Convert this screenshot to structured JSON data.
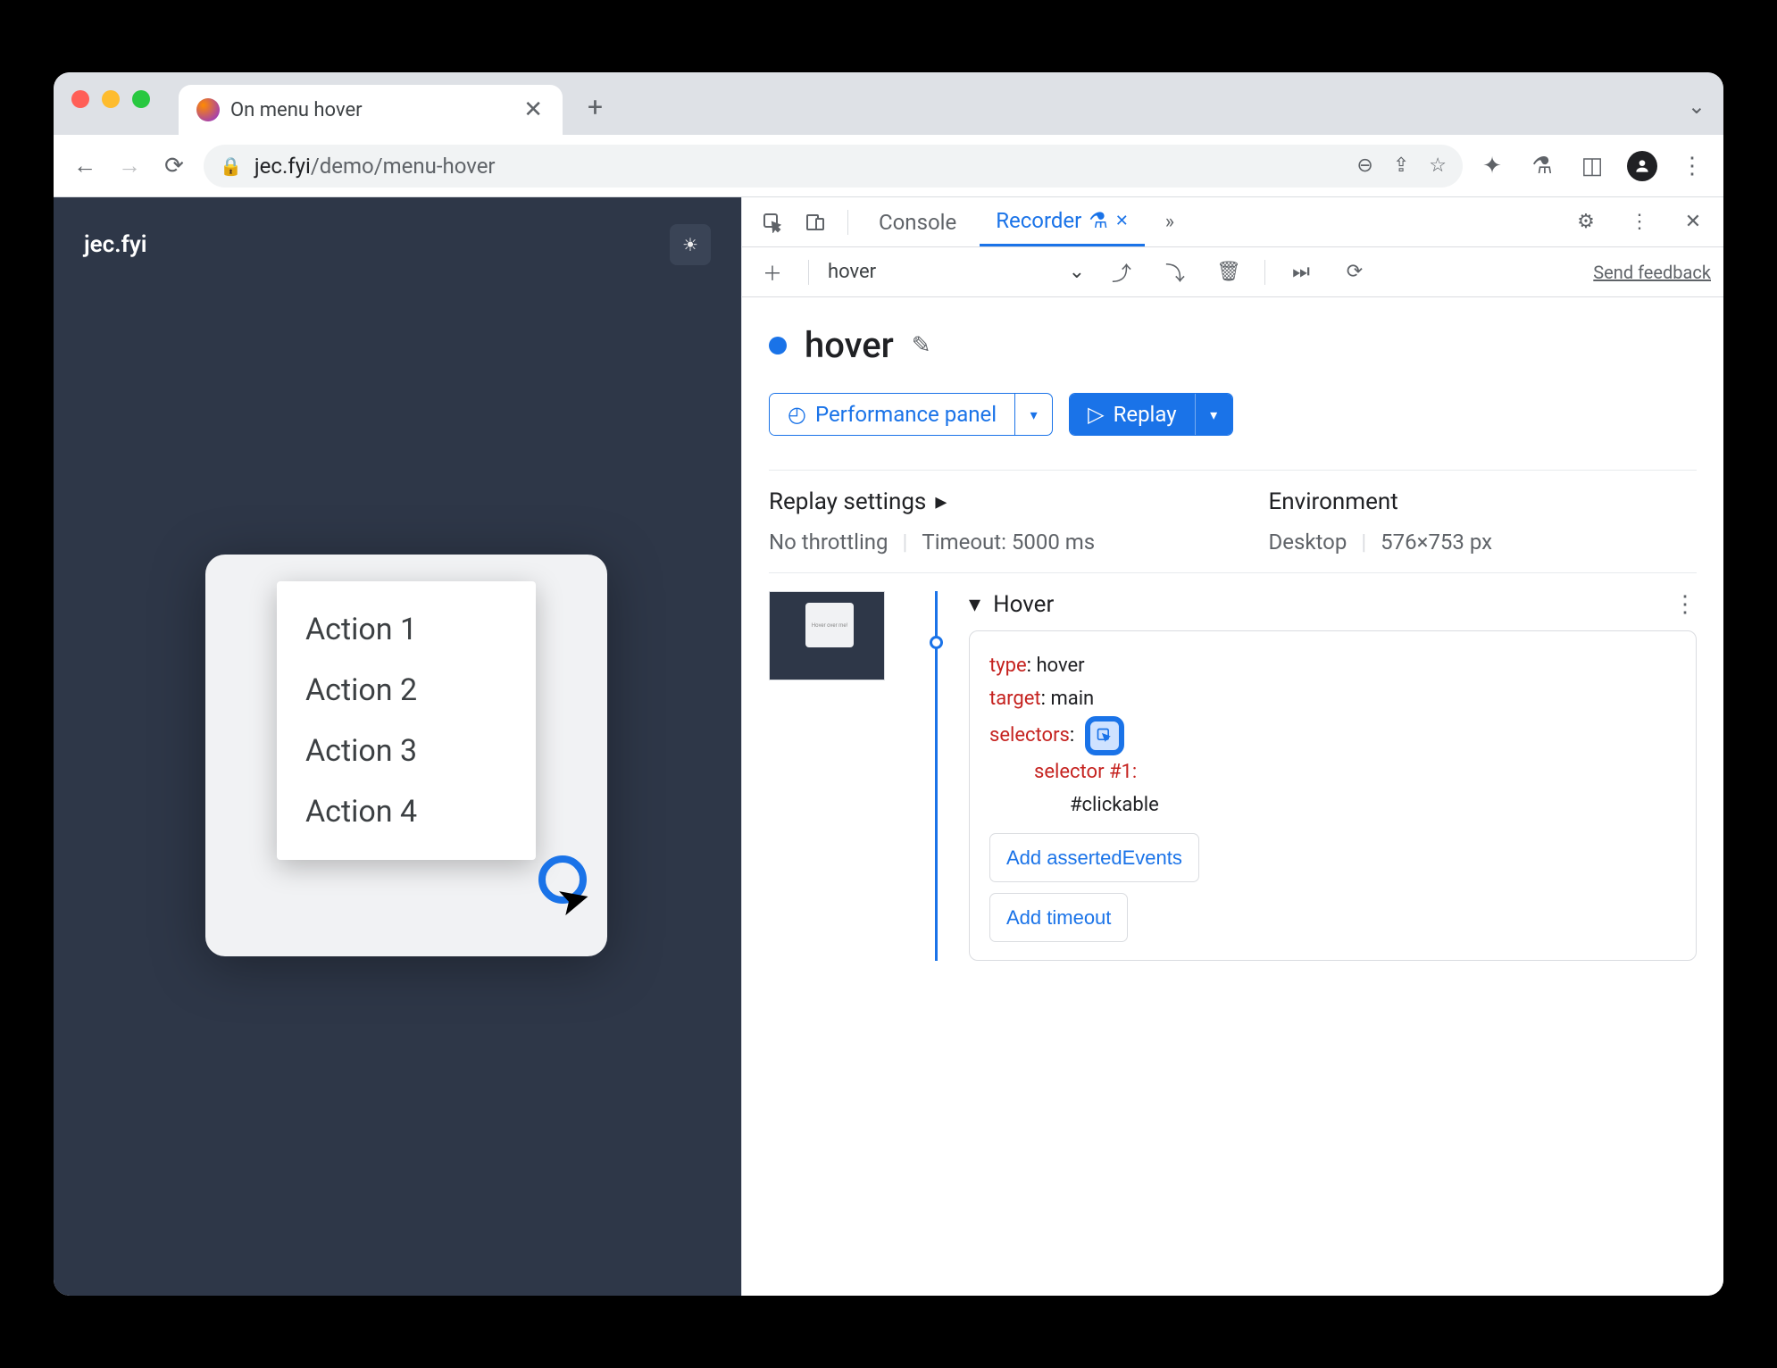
{
  "browser": {
    "tab_title": "On menu hover",
    "url_host": "jec.fyi",
    "url_path": "/demo/menu-hover"
  },
  "page_content": {
    "logo": "jec.fyi",
    "hover_text": "Hover over me!",
    "menu_items": [
      "Action 1",
      "Action 2",
      "Action 3",
      "Action 4"
    ]
  },
  "devtools": {
    "tabs": {
      "console": "Console",
      "recorder": "Recorder"
    },
    "recording_selector": "hover",
    "send_feedback": "Send feedback",
    "recording_title": "hover",
    "performance_btn": "Performance panel",
    "replay_btn": "Replay",
    "settings": {
      "replay_title": "Replay settings",
      "env_title": "Environment",
      "throttling": "No throttling",
      "timeout": "Timeout: 5000 ms",
      "device": "Desktop",
      "viewport": "576×753 px"
    },
    "step": {
      "name": "Hover",
      "type_key": "type",
      "type_val": "hover",
      "target_key": "target",
      "target_val": "main",
      "selectors_key": "selectors",
      "selector_num": "selector #1",
      "selector_val": "#clickable",
      "add_asserted": "Add assertedEvents",
      "add_timeout": "Add timeout"
    },
    "thumb_text": "Hover over me!"
  }
}
